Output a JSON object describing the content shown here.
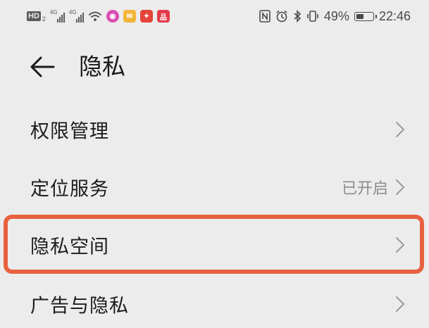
{
  "status_bar": {
    "hd_label": "HD",
    "hd_sub": "2",
    "sim1_network": "4G",
    "sim2_network": "4G",
    "wifi_icon": "wifi-icon",
    "app_icons": [
      {
        "name": "pink-app-icon",
        "color": "#d94fb3",
        "glyph": "◉"
      },
      {
        "name": "mail-app-icon",
        "color": "#f2b53a",
        "glyph": "✉"
      },
      {
        "name": "red-app-icon",
        "color": "#e4443a",
        "glyph": "✦"
      },
      {
        "name": "shop-app-icon",
        "color": "#e23c4a",
        "glyph": "品"
      }
    ],
    "nfc_icon": "nfc-icon",
    "alarm_icon": "alarm-icon",
    "bluetooth_icon": "bluetooth-icon",
    "vibrate_icon": "vibrate-icon",
    "battery_percent": "49%",
    "battery_level": 0.49,
    "time": "22:46"
  },
  "header": {
    "back_icon": "back-arrow-icon",
    "title": "隐私"
  },
  "menu": {
    "items": [
      {
        "label": "权限管理",
        "value": ""
      },
      {
        "label": "定位服务",
        "value": "已开启"
      },
      {
        "label": "隐私空间",
        "value": "",
        "highlighted": true
      },
      {
        "label": "广告与隐私",
        "value": ""
      }
    ]
  },
  "colors": {
    "background": "#ececec",
    "highlight_border": "#e8613f",
    "secondary_text": "#8c8c8c",
    "chevron": "#9a9a9a"
  }
}
